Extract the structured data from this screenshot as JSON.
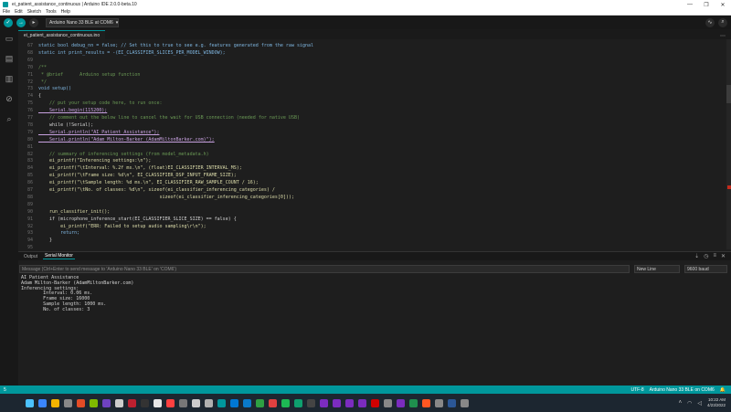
{
  "window": {
    "title": "ei_patient_assistance_continuous | Arduino IDE 2.0.0-beta.10",
    "controls": [
      "—",
      "❐",
      "✕"
    ]
  },
  "menubar": {
    "items": [
      "File",
      "Edit",
      "Sketch",
      "Tools",
      "Help"
    ]
  },
  "toolbar": {
    "verify_icon": "check-icon",
    "upload_icon": "arrow-right-icon",
    "debug_icon": "debug-icon",
    "board_label": "Arduino Nano 33 BLE at COM6",
    "board_caret": "▾",
    "serial_plotter_icon": "plotter-icon",
    "serial_monitor_icon": "magnifier-icon"
  },
  "tab": {
    "filename": "ei_patient_assistance_continuous.ino",
    "menu_glyph": "⋯"
  },
  "editor": {
    "lines": [
      {
        "n": "67",
        "code": "static bool debug_nn = false; // Set this to true to see e.g. features generated from the raw signal",
        "cls": "keyword"
      },
      {
        "n": "68",
        "code": "static int print_results = -(EI_CLASSIFIER_SLICES_PER_MODEL_WINDOW);",
        "cls": "keyword"
      },
      {
        "n": "69",
        "code": "",
        "cls": ""
      },
      {
        "n": "70",
        "code": "/**",
        "cls": "comment"
      },
      {
        "n": "71",
        "code": " * @brief      Arduino setup function",
        "cls": "comment"
      },
      {
        "n": "72",
        "code": " */",
        "cls": "comment"
      },
      {
        "n": "73",
        "code": "void setup()",
        "cls": "keyword"
      },
      {
        "n": "74",
        "code": "{",
        "cls": ""
      },
      {
        "n": "75",
        "code": "    // put your setup code here, to run once:",
        "cls": "comment"
      },
      {
        "n": "76",
        "code": "    Serial.begin(115200);",
        "cls": "serial"
      },
      {
        "n": "77",
        "code": "    // comment out the below line to cancel the wait for USB connection (needed for native USB)",
        "cls": "comment"
      },
      {
        "n": "78",
        "code": "    while (!Serial);",
        "cls": ""
      },
      {
        "n": "79",
        "code": "    Serial.println(\"AI Patient Assistance\");",
        "cls": "serial"
      },
      {
        "n": "80",
        "code": "    Serial.println(\"Adam Milton-Barker (AdamMiltonBarker.com)\");",
        "cls": "serial"
      },
      {
        "n": "81",
        "code": "",
        "cls": ""
      },
      {
        "n": "82",
        "code": "    // summary of inferencing settings (from model_metadata.h)",
        "cls": "comment"
      },
      {
        "n": "83",
        "code": "    ei_printf(\"Inferencing settings:\\n\");",
        "cls": "func"
      },
      {
        "n": "84",
        "code": "    ei_printf(\"\\tInterval: %.2f ms.\\n\", (float)EI_CLASSIFIER_INTERVAL_MS);",
        "cls": "func"
      },
      {
        "n": "85",
        "code": "    ei_printf(\"\\tFrame size: %d\\n\", EI_CLASSIFIER_DSP_INPUT_FRAME_SIZE);",
        "cls": "func"
      },
      {
        "n": "86",
        "code": "    ei_printf(\"\\tSample length: %d ms.\\n\", EI_CLASSIFIER_RAW_SAMPLE_COUNT / 16);",
        "cls": "func"
      },
      {
        "n": "87",
        "code": "    ei_printf(\"\\tNo. of classes: %d\\n\", sizeof(ei_classifier_inferencing_categories) /",
        "cls": "func"
      },
      {
        "n": "88",
        "code": "                                            sizeof(ei_classifier_inferencing_categories[0]));",
        "cls": "func"
      },
      {
        "n": "89",
        "code": "",
        "cls": ""
      },
      {
        "n": "90",
        "code": "    run_classifier_init();",
        "cls": "func"
      },
      {
        "n": "91",
        "code": "    if (microphone_inference_start(EI_CLASSIFIER_SLICE_SIZE) == false) {",
        "cls": ""
      },
      {
        "n": "92",
        "code": "        ei_printf(\"ERR: Failed to setup audio sampling\\r\\n\");",
        "cls": "func"
      },
      {
        "n": "93",
        "code": "        return;",
        "cls": "keyword"
      },
      {
        "n": "94",
        "code": "    }",
        "cls": ""
      },
      {
        "n": "95",
        "code": "",
        "cls": ""
      }
    ]
  },
  "panel": {
    "tabs": [
      "Output",
      "Serial Monitor"
    ],
    "active_tab": "Serial Monitor",
    "message_placeholder": "Message (Ctrl+Enter to send message to 'Arduino Nano 33 BLE' on 'COM6')",
    "line_ending": "New Line",
    "baud": "9600 baud",
    "output_lines": [
      "AI Patient Assistance",
      "Adam Milton-Barker (AdamMiltonBarker.com)",
      "Inferencing settings:",
      "        Interval: 0.06 ms.",
      "        Frame size: 16000",
      "        Sample length: 1000 ms.",
      "        No. of classes: 3"
    ]
  },
  "status": {
    "left": "5",
    "encoding": "UTF-8",
    "board": "Arduino Nano 33 BLE on COM6",
    "bell": "🔔"
  },
  "taskbar": {
    "time": "10:22 AM",
    "date": "4/23/2022",
    "icon_colors": [
      "#3a86ff",
      "#f4b400",
      "#888888",
      "#e34c26",
      "#7fba00",
      "#6f42c1",
      "#cccccc",
      "#bb2030",
      "#333333",
      "#e6e6e6",
      "#ff4040",
      "#777777",
      "#cccccc",
      "#b0b0b0",
      "#00979c",
      "#0078d4",
      "#0a7aca",
      "#2ea043",
      "#e04040",
      "#1db954",
      "#0e9f6e",
      "#444444",
      "#7b2cbf",
      "#7b2cbf",
      "#7b2cbf",
      "#7b2cbf",
      "#d00000",
      "#888888",
      "#7b2cbf",
      "#1f8f4e",
      "#ff5722",
      "#888888",
      "#2b5797",
      "#888888"
    ]
  },
  "colors": {
    "accent": "#00979c",
    "background": "#1e1e1e",
    "error_marker": "#c42b1c"
  }
}
